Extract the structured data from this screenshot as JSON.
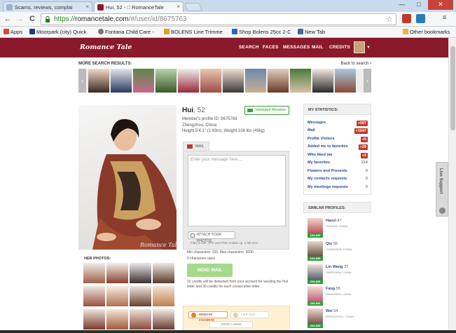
{
  "browser": {
    "tabs": [
      {
        "title": "Scams, reviews, complai",
        "icon_color": "#9bb3d4"
      },
      {
        "title": "Hui, 52 - □ RomanceTale",
        "icon_color": "#8a1a2b"
      }
    ],
    "window_controls": {
      "minimize": "—",
      "maximize": "□",
      "close": "✕"
    },
    "nav": {
      "back": "←",
      "forward": "→",
      "reload": "C"
    },
    "url": {
      "scheme": "https://",
      "host": "romancetale.com",
      "path": "/#/user/id/8675763"
    },
    "star": "☆",
    "bookmarks": [
      {
        "label": "Apps",
        "icon_color": "#d84a38"
      },
      {
        "label": "Moorpark (city) Quick",
        "icon_color": "#1e3f75"
      },
      {
        "label": "Fontana Child Care - ",
        "icon_color": "#777777"
      },
      {
        "label": "BOLENS Line Trimme",
        "icon_color": "#e0a020"
      },
      {
        "label": "Shop Bolens 25cc 2-C",
        "icon_color": "#2b64c0"
      },
      {
        "label": "New Tab",
        "icon_color": "#3a6a9a"
      },
      {
        "label": "Other bookmarks",
        "icon_color": "#e8b93c"
      }
    ]
  },
  "site": {
    "logo": "Romance Tale",
    "nav": [
      "SEARCH",
      "FACES",
      "MESSAGES",
      "MAIL",
      "CREDITS"
    ],
    "brand_color": "#8a1a2b"
  },
  "search_strip": {
    "label": "MORE SEARCH RESULTS:",
    "back_link": "Back to search ›",
    "prev": "‹",
    "next": "›"
  },
  "profile": {
    "name": "Hui",
    "age": ", 52",
    "verified": "Validated Member",
    "profile_id": "Member's profile ID: 8675763",
    "location": "Zhengzhou, China",
    "stats": "Height 5'4.1\" (1.63m), Weight 108 lbs (49kg)",
    "watermark": "Romance Tale",
    "her_photos_label": "HER PHOTOS:"
  },
  "mail": {
    "tab": "MAIL",
    "placeholder": "Enter your message here....",
    "attach_button": "ATTACH YOUR PHOTOS",
    "attach_note": "Files in GIF, JPG and PNG mobile up. 4 Mb size.",
    "limits": "Min characters: 150, Max characters: 3000",
    "used": "0 characters used",
    "send": "SEND MAIL",
    "credits_note": "10 credits will be deducted from your account for sending the first letter and 30 credits for each consecutive letter."
  },
  "actions": {
    "remove_favorite": "REMOVE FAVORITE",
    "like": "LIKE HER",
    "wink": "SEND A WINK"
  },
  "my_stats": {
    "title": "MY STATISTICS:",
    "rows": [
      {
        "label": "Messages",
        "value": "+587",
        "badge": true
      },
      {
        "label": "Mail",
        "value": "+1647",
        "badge": true
      },
      {
        "label": "Profile Visitors",
        "value": "+5",
        "badge": true
      },
      {
        "label": "Added me to favorites",
        "value": "+29",
        "badge": true
      },
      {
        "label": "Who liked me",
        "value": "+2",
        "badge": true
      },
      {
        "label": "My favorites",
        "value": "214",
        "badge": false
      },
      {
        "label": "Flowers and Presents",
        "value": "0",
        "badge": false
      },
      {
        "label": "My contacts requests",
        "value": "0",
        "badge": false
      },
      {
        "label": "My meetings requests",
        "value": "0",
        "badge": false
      }
    ]
  },
  "similar": {
    "title": "SIMILAR PROFILES:",
    "online_label": "ONLINE",
    "items": [
      {
        "name": "Haoxi",
        "age": "47",
        "location": "FUSHUN, CHINA"
      },
      {
        "name": "Qiu",
        "age": "50",
        "location": "CHANGSHA, CHINA"
      },
      {
        "name": "Lin Wang",
        "age": "37",
        "location": "SHENZHEN, CHINA"
      },
      {
        "name": "Fang",
        "age": "55",
        "location": "SHENZHEN, CHINA"
      },
      {
        "name": "Wei",
        "age": "54",
        "location": "ZHENGZHOU, CHINA"
      }
    ]
  },
  "live_support": {
    "label": "Live Support"
  }
}
